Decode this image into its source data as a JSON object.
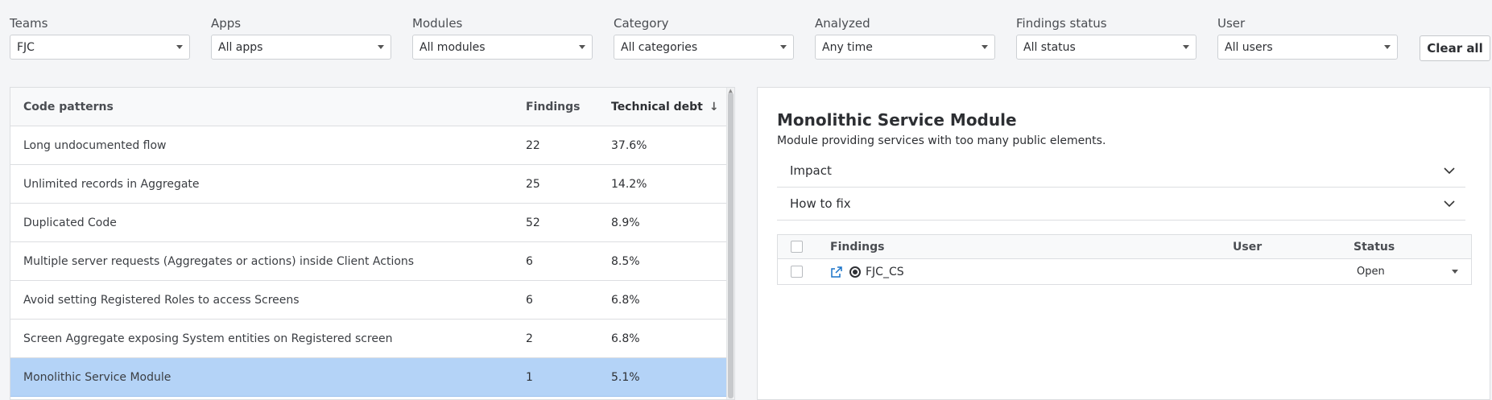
{
  "filters": [
    {
      "label": "Teams",
      "value": "FJC"
    },
    {
      "label": "Apps",
      "value": "All apps"
    },
    {
      "label": "Modules",
      "value": "All modules"
    },
    {
      "label": "Category",
      "value": "All categories"
    },
    {
      "label": "Analyzed",
      "value": "Any time"
    },
    {
      "label": "Findings status",
      "value": "All status"
    },
    {
      "label": "User",
      "value": "All users"
    }
  ],
  "clear_all_label": "Clear all",
  "patterns_table": {
    "headers": {
      "pattern": "Code patterns",
      "findings": "Findings",
      "debt": "Technical debt"
    },
    "rows": [
      {
        "pattern": "Long undocumented flow",
        "findings": "22",
        "debt": "37.6%"
      },
      {
        "pattern": "Unlimited records in Aggregate",
        "findings": "25",
        "debt": "14.2%"
      },
      {
        "pattern": "Duplicated Code",
        "findings": "52",
        "debt": "8.9%"
      },
      {
        "pattern": "Multiple server requests (Aggregates or actions) inside Client Actions",
        "findings": "6",
        "debt": "8.5%"
      },
      {
        "pattern": "Avoid setting Registered Roles to access Screens",
        "findings": "6",
        "debt": "6.8%"
      },
      {
        "pattern": "Screen Aggregate exposing System entities on Registered screen",
        "findings": "2",
        "debt": "6.8%"
      },
      {
        "pattern": "Monolithic Service Module",
        "findings": "1",
        "debt": "5.1%"
      }
    ],
    "selected_index": 6
  },
  "detail": {
    "title": "Monolithic Service Module",
    "description": "Module providing services with too many public elements.",
    "accordions": [
      {
        "label": "Impact"
      },
      {
        "label": "How to fix"
      }
    ],
    "findings_table": {
      "headers": {
        "findings": "Findings",
        "user": "User",
        "status": "Status"
      },
      "rows": [
        {
          "name": "FJC_CS",
          "user": "",
          "status": "Open"
        }
      ]
    }
  },
  "colors": {
    "selected_row": "#b4d3f7",
    "link_icon": "#1a73c8"
  }
}
